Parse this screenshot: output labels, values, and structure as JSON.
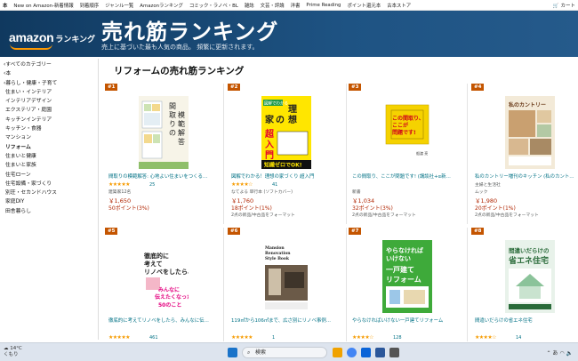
{
  "topnav": {
    "items": [
      "本",
      "New on Amazon-新着情報",
      "到着順序",
      "ジャンル一覧",
      "Amazonランキング",
      "コミック・ラノベ・BL",
      "雑誌",
      "文芸・評論",
      "洋書",
      "Prime Reading",
      "ポイント還元本",
      "古本ストア"
    ],
    "cart_label": "カート"
  },
  "banner": {
    "logo_text": "amazon",
    "logo_sub": "ランキング",
    "title": "売れ筋ランキング",
    "subtitle": "売上に基づいた最も人気の商品。 頻繁に更新されます。"
  },
  "sidebar": {
    "items": [
      "‹すべてのカテゴリー",
      "‹本",
      "‹暮らし・健康・子育て",
      "住まい・インテリア",
      "インテリアデザイン",
      "エクステリア・庭園",
      "キッチンインテリア",
      "キッチン・食器",
      "マンション",
      "リフォーム",
      "住まいと健康",
      "住まいと家族",
      "住宅ローン",
      "住宅設備・家づくり",
      "別荘・セカンドハウス",
      "家庭DIY",
      "田舎暮らし"
    ]
  },
  "main": {
    "title": "リフォームの売れ筋ランキング"
  },
  "products": [
    {
      "rank": "#1",
      "cover_text": "間取りの模範解答",
      "title": "間取りの模範解答: 心地よい住まいをつくる…",
      "stars": "★★★★★",
      "reviews": "25",
      "author": "建築家12名",
      "price": "￥1,650",
      "points": "50ポイント(3%)",
      "note": ""
    },
    {
      "rank": "#2",
      "cover_text": "理想の家づくり超入門",
      "title": "図解でわかる！理想の家づくり 超入門",
      "stars": "★★★★☆",
      "reviews": "41",
      "author": "なてよる",
      "extra": "単行本 (ソフトカバー)",
      "price": "￥1,760",
      "points": "18ポイント(1%)",
      "note": "2点の新品/中古品をフォーマット"
    },
    {
      "rank": "#3",
      "cover_text": "この間取り、ここが問題です!",
      "title": "この間取り、ここが問題です! (講談社+α新…",
      "stars": "",
      "reviews": "",
      "author": "新書",
      "price": "￥1,034",
      "points": "32ポイント(3%)",
      "note": "2点の新品/中古品をフォーマット"
    },
    {
      "rank": "#4",
      "cover_text": "私のカントリー",
      "title": "私のカントリー増刊のキッチン (私のカント…",
      "stars": "",
      "reviews": "",
      "author": "主婦と生活社",
      "extra": "ムック",
      "price": "￥1,980",
      "points": "20ポイント(1%)",
      "note": "2点の新品/中古品をフォーマット"
    },
    {
      "rank": "#5",
      "cover_text": "徹底的に考えてリノベをしたら、みんなに伝えたくなった50のこと",
      "title": "徹底的に考えてリノベをしたら、みんなに伝…",
      "stars": "★★★★★",
      "reviews": "461",
      "author": "",
      "price": "",
      "points": "",
      "note": ""
    },
    {
      "rank": "#6",
      "cover_text": "Mansion Renovation Style Book",
      "title": "119㎡から106㎡まで、広さ別にリノベ事例…",
      "stars": "★★★★★",
      "reviews": "1",
      "author": "",
      "price": "",
      "points": "",
      "note": ""
    },
    {
      "rank": "#7",
      "cover_text": "やらなければいけない一戸建てリフォーム",
      "title": "やらなければいけない一戸建てリフォーム",
      "stars": "★★★★☆",
      "reviews": "128",
      "author": "",
      "price": "",
      "points": "",
      "note": ""
    },
    {
      "rank": "#8",
      "cover_text": "間違いだらけの省エネ住宅",
      "title": "間違いだらけの省エネ住宅",
      "stars": "★★★★☆",
      "reviews": "14",
      "author": "",
      "price": "",
      "points": "",
      "note": ""
    }
  ],
  "taskbar": {
    "weather_temp": "14°C",
    "weather_desc": "くもり",
    "search_label": "検索",
    "tray_text": "あ"
  }
}
